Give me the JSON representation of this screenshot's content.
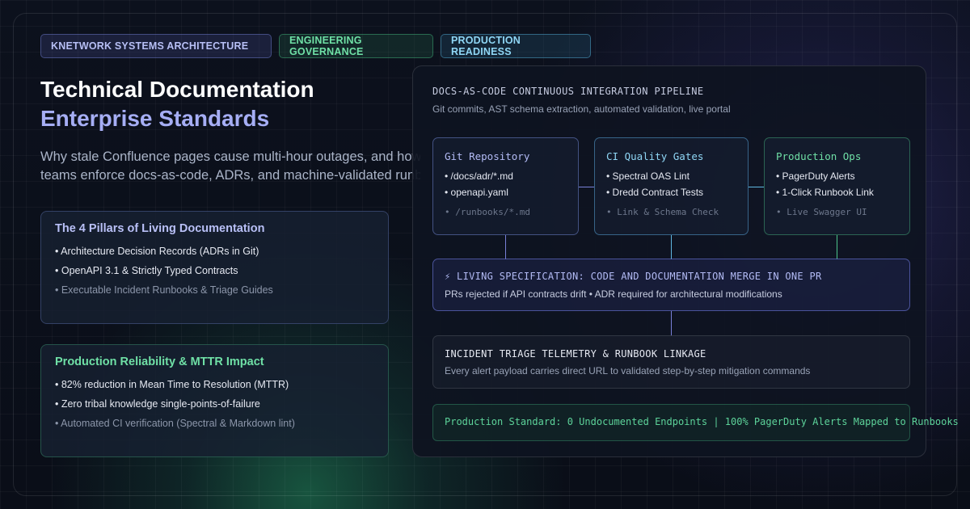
{
  "tags": [
    {
      "label": "KNETWORK SYSTEMS ARCHITECTURE",
      "color": "#b7bff5"
    },
    {
      "label": "ENGINEERING GOVERNANCE",
      "color": "#6fe0a6"
    },
    {
      "label": "PRODUCTION READINESS",
      "color": "#8fd6f5"
    }
  ],
  "hero": {
    "title_line1": "Technical Documentation",
    "title_line2": "Enterprise Standards",
    "subtitle_line1": "Why stale Confluence pages cause multi-hour outages, and how modern",
    "subtitle_line2": "teams enforce docs-as-code, ADRs, and machine-validated runbooks."
  },
  "pillars_card": {
    "heading": "The 4 Pillars of Living Documentation",
    "items": [
      "• Architecture Decision Records (ADRs in Git)",
      "• OpenAPI 3.1 & Strictly Typed Contracts",
      "• Executable Incident Runbooks & Triage Guides"
    ]
  },
  "reliability_card": {
    "heading": "Production Reliability & MTTR Impact",
    "items": [
      "• 82% reduction in Mean Time to Resolution (MTTR)",
      "• Zero tribal knowledge single-points-of-failure",
      "• Automated CI verification (Spectral & Markdown lint)"
    ]
  },
  "pipeline": {
    "title": "DOCS-AS-CODE CONTINUOUS INTEGRATION PIPELINE",
    "subtitle": "Git commits, AST schema extraction, automated validation, live portal",
    "stages": [
      {
        "title": "Git Repository",
        "items": [
          "• /docs/adr/*.md",
          "• openapi.yaml"
        ],
        "note": "• /runbooks/*.md"
      },
      {
        "title": "CI Quality Gates",
        "items": [
          "• Spectral OAS Lint",
          "• Dredd Contract Tests"
        ],
        "note": "• Link & Schema Check"
      },
      {
        "title": "Production Ops",
        "items": [
          "• PagerDuty Alerts",
          "• 1-Click Runbook Link"
        ],
        "note": "• Live Swagger UI"
      }
    ],
    "living_spec": {
      "title": "⚡ LIVING SPECIFICATION: CODE AND DOCUMENTATION MERGE IN ONE PR",
      "subtitle": "PRs rejected if API contracts drift • ADR required for architectural modifications"
    },
    "incident": {
      "title": "INCIDENT TRIAGE TELEMETRY & RUNBOOK LINKAGE",
      "subtitle": "Every alert payload carries direct URL to validated step-by-step mitigation commands"
    },
    "standard": "Production Standard: 0 Undocumented Endpoints | 100% PagerDuty Alerts Mapped to Runbooks"
  }
}
